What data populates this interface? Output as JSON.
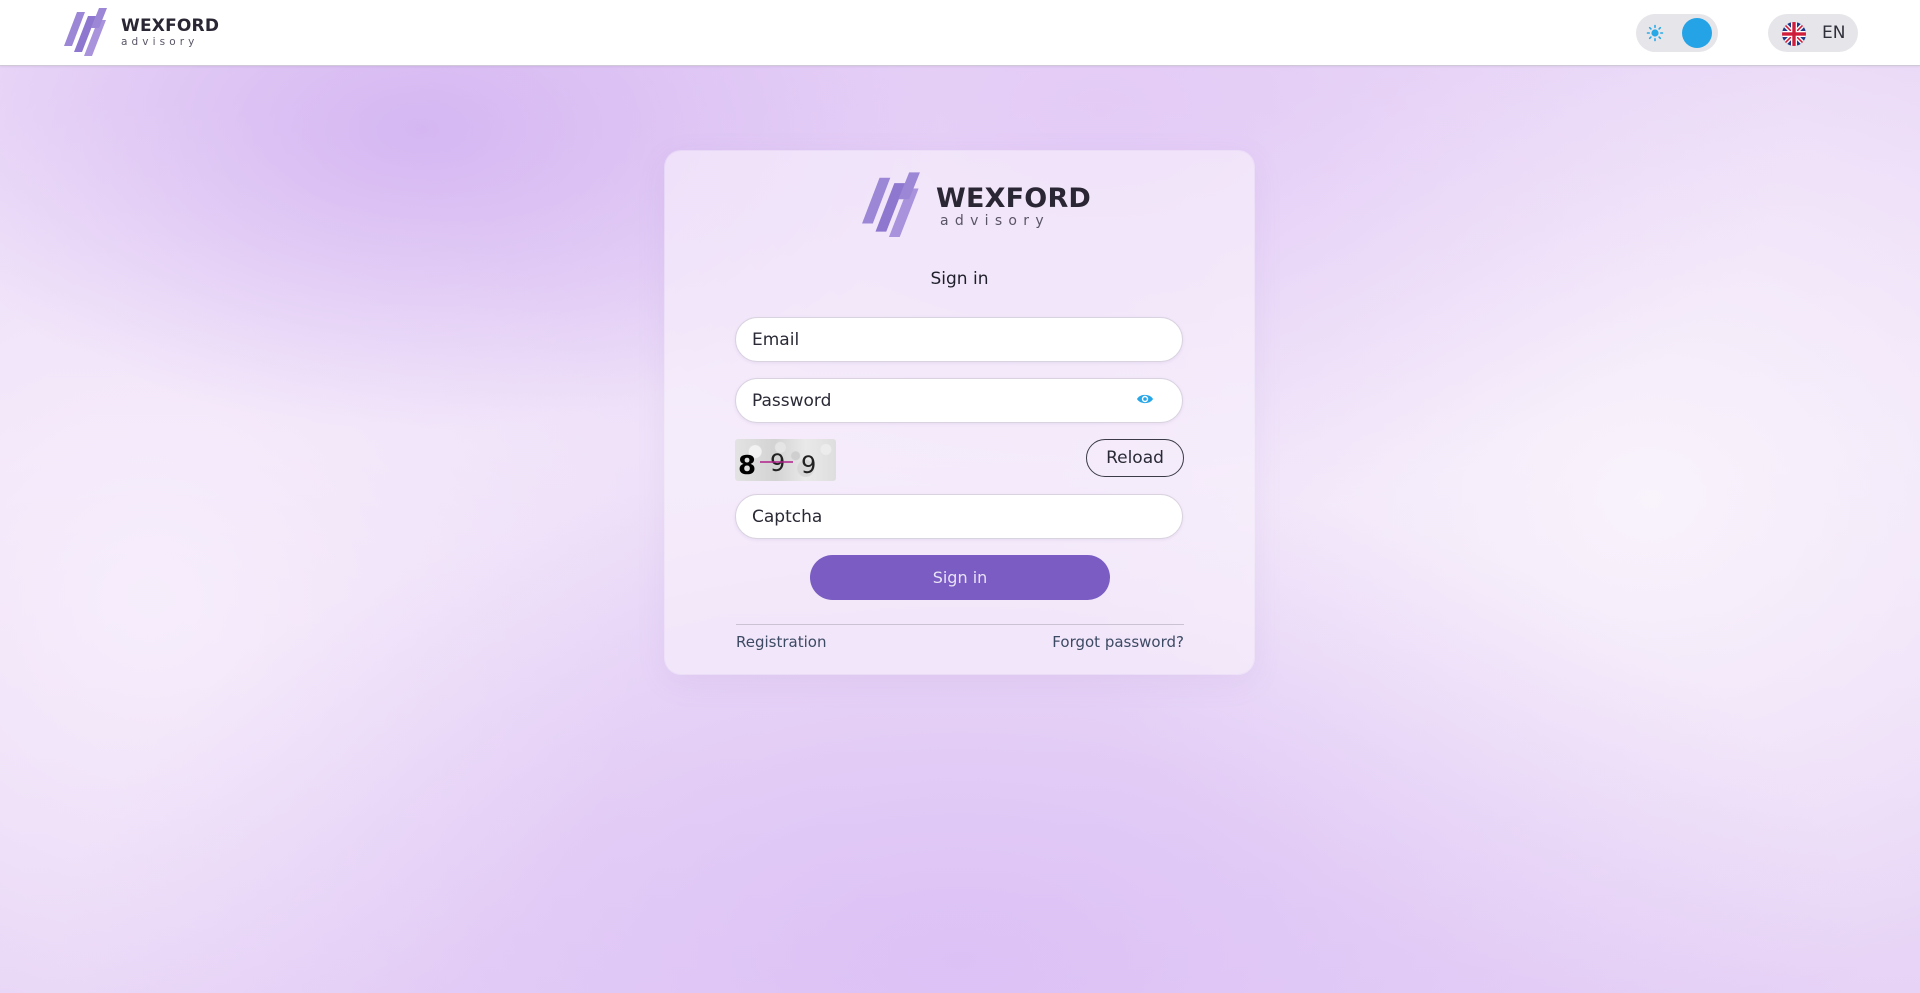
{
  "brand": {
    "name": "WEXFORD",
    "tagline": "advisory",
    "logo_color": "#9c86d6"
  },
  "header": {
    "theme_toggle": {
      "state": "dark",
      "sun_icon": "sun-icon",
      "moon_icon": "moon-icon",
      "accent": "#24a4e6"
    },
    "language": {
      "flag_icon": "uk-flag-icon",
      "label": "EN"
    }
  },
  "login": {
    "title": "Sign in",
    "email": {
      "placeholder": "Email",
      "value": ""
    },
    "password": {
      "placeholder": "Password",
      "value": "",
      "toggle_icon": "eye-icon"
    },
    "captcha": {
      "image_text": "8 9 9",
      "reload_label": "Reload",
      "placeholder": "Captcha",
      "value": ""
    },
    "submit_label": "Sign in",
    "submit_color": "#7a5cc2",
    "register_link": "Registration",
    "forgot_link": "Forgot password?"
  }
}
